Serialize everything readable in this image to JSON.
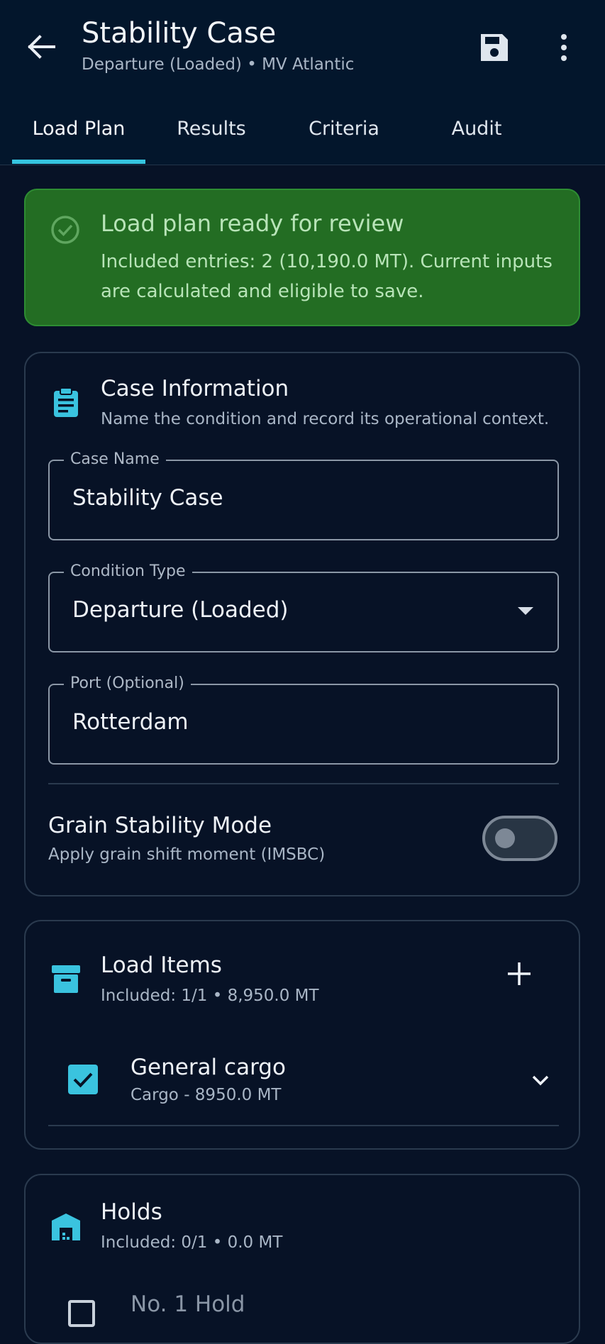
{
  "header": {
    "title": "Stability Case",
    "subtitle": "Departure (Loaded) • MV Atlantic",
    "back_icon": "arrow-left-icon",
    "save_icon": "save-icon",
    "more_icon": "more-vertical-icon"
  },
  "tabs": [
    {
      "label": "Load Plan",
      "active": true
    },
    {
      "label": "Results",
      "active": false
    },
    {
      "label": "Criteria",
      "active": false
    },
    {
      "label": "Audit",
      "active": false
    }
  ],
  "alert": {
    "title": "Load plan ready for review",
    "text": "Included entries: 2 (10,190.0 MT). Current inputs are calculated and eligible to save.",
    "icon": "check-circle-icon",
    "color": "#236d23"
  },
  "case_info": {
    "title": "Case Information",
    "subtitle": "Name the condition and record its operational context.",
    "icon": "clipboard-icon",
    "fields": {
      "case_name": {
        "label": "Case Name",
        "value": "Stability Case"
      },
      "condition_type": {
        "label": "Condition Type",
        "value": "Departure (Loaded)"
      },
      "port": {
        "label": "Port (Optional)",
        "value": "Rotterdam"
      }
    },
    "grain": {
      "title": "Grain Stability Mode",
      "subtitle": "Apply grain shift moment (IMSBC)",
      "enabled": false
    }
  },
  "load_items": {
    "title": "Load Items",
    "subtitle": "Included: 1/1 • 8,950.0 MT",
    "icon": "archive-icon",
    "add_icon": "plus-icon",
    "items": [
      {
        "title": "General cargo",
        "subtitle": "Cargo - 8950.0 MT",
        "checked": true
      }
    ]
  },
  "holds": {
    "title": "Holds",
    "subtitle": "Included: 0/1 • 0.0 MT",
    "icon": "warehouse-icon",
    "items": [
      {
        "title": "No. 1 Hold",
        "checked": false
      }
    ]
  },
  "colors": {
    "accent": "#35c4df",
    "background": "#071226",
    "header_bg": "#03162c"
  }
}
